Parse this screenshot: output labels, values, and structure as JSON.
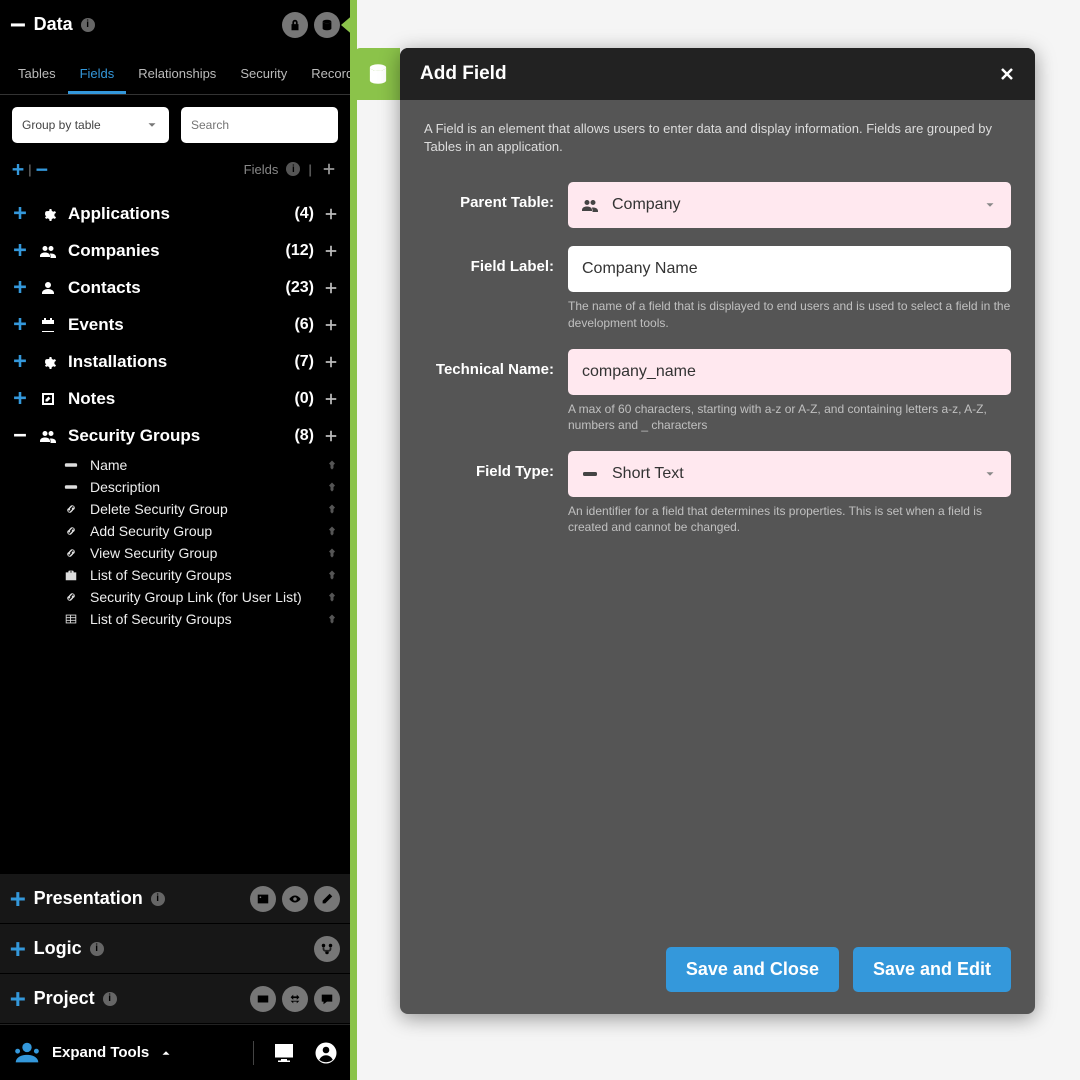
{
  "sidebar": {
    "sections": {
      "data": {
        "label": "Data",
        "expanded": true
      },
      "presentation": {
        "label": "Presentation"
      },
      "logic": {
        "label": "Logic"
      },
      "project": {
        "label": "Project"
      }
    },
    "tabs": [
      "Tables",
      "Fields",
      "Relationships",
      "Security",
      "Records"
    ],
    "active_tab_index": 1,
    "group_dropdown": "Group by table",
    "search_placeholder": "Search",
    "util_label": "Fields",
    "categories": [
      {
        "label": "Applications",
        "count": "(4)",
        "icon": "gear",
        "expanded": false
      },
      {
        "label": "Companies",
        "count": "(12)",
        "icon": "users",
        "expanded": false
      },
      {
        "label": "Contacts",
        "count": "(23)",
        "icon": "user",
        "expanded": false
      },
      {
        "label": "Events",
        "count": "(6)",
        "icon": "calendar",
        "expanded": false
      },
      {
        "label": "Installations",
        "count": "(7)",
        "icon": "gear",
        "expanded": false
      },
      {
        "label": "Notes",
        "count": "(0)",
        "icon": "pencil-sq",
        "expanded": false
      },
      {
        "label": "Security Groups",
        "count": "(8)",
        "icon": "users-gear",
        "expanded": true,
        "fields": [
          {
            "label": "Name",
            "icon": "bar"
          },
          {
            "label": "Description",
            "icon": "bar"
          },
          {
            "label": "Delete Security Group",
            "icon": "link"
          },
          {
            "label": "Add Security Group",
            "icon": "link"
          },
          {
            "label": "View Security Group",
            "icon": "link"
          },
          {
            "label": "List of Security Groups",
            "icon": "briefcase"
          },
          {
            "label": "Security Group Link (for User List)",
            "icon": "link"
          },
          {
            "label": "List of Security Groups",
            "icon": "table"
          }
        ]
      }
    ],
    "footer": {
      "expand": "Expand Tools"
    }
  },
  "modal": {
    "title": "Add Field",
    "desc": "A Field is an element that allows users to enter data and display information. Fields are grouped by Tables in an application.",
    "labels": {
      "parent_table": "Parent Table:",
      "field_label": "Field Label:",
      "technical_name": "Technical Name:",
      "field_type": "Field Type:"
    },
    "values": {
      "parent_table": "Company",
      "field_label": "Company Name",
      "technical_name": "company_name",
      "field_type": "Short Text"
    },
    "help": {
      "field_label": "The name of a field that is displayed to end users and is used to select a field in the development tools.",
      "technical_name": "A max of 60 characters, starting with a-z or A-Z, and containing letters a-z, A-Z, numbers and _ characters",
      "field_type": "An identifier for a field that determines its properties. This is set when a field is created and cannot be changed."
    },
    "buttons": {
      "save_close": "Save and Close",
      "save_edit": "Save and Edit"
    }
  }
}
